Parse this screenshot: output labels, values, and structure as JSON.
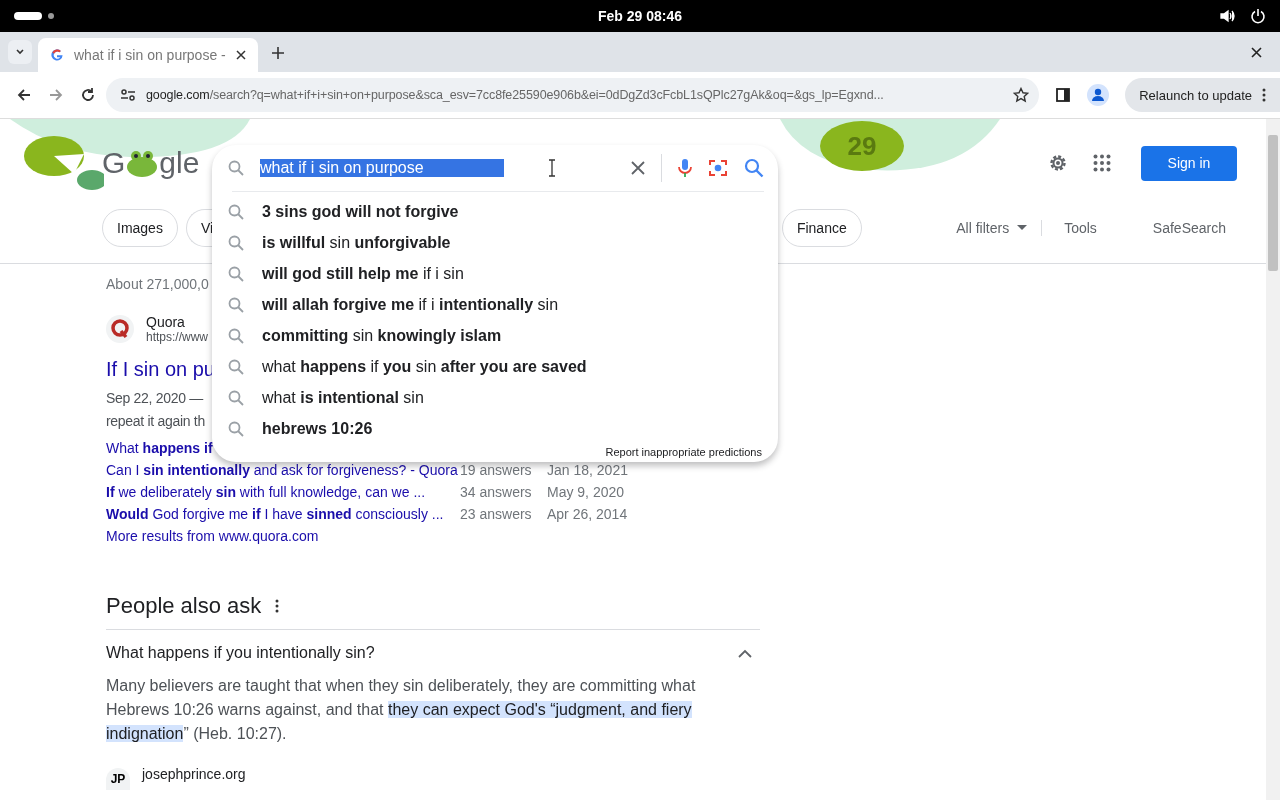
{
  "system_bar": {
    "clock": "Feb 29  08:46"
  },
  "tabs": [
    {
      "title": "what if i sin on purpose -",
      "selected": true
    }
  ],
  "toolbar": {
    "url_host": "google.com",
    "url_path": "/search?q=what+if+i+sin+on+purpose&sca_esv=7cc8fe25590e906b&ei=0dDgZd3cFcbL1sQPlc27gAk&oq=&gs_lp=Egxnd...",
    "relaunch": "Relaunch to update"
  },
  "logo": {
    "left": "G",
    "right": "gle",
    "doodle_number": "29"
  },
  "search": {
    "value": "what if i sin on purpose",
    "selected": true
  },
  "suggestions": [
    {
      "text": "**3 sins god will not forgive**"
    },
    {
      "text": "**is willful** sin **unforgivable**"
    },
    {
      "text": "**will god still help me** if i sin"
    },
    {
      "text": "**will allah forgive me** if i **intentionally** sin"
    },
    {
      "text": "**committing** sin **knowingly islam**"
    },
    {
      "text": "what **happens** if **you** sin **after you are saved**"
    },
    {
      "text": "what **is intentional** sin"
    },
    {
      "text": "**hebrews 10:26**"
    }
  ],
  "report_link": "Report inappropriate predictions",
  "sign_in": "Sign in",
  "chips": [
    {
      "label": "Images"
    },
    {
      "label": "Vi"
    },
    {
      "label": "Finance"
    }
  ],
  "filters": [
    {
      "label": "All filters",
      "kind": "dropdown"
    },
    {
      "label": "Tools",
      "kind": "plain"
    },
    {
      "label": "SafeSearch",
      "kind": "plain"
    }
  ],
  "result_stats": "About 271,000,0",
  "result": {
    "site": "Quora",
    "url": "https://www",
    "title": "If I sin on pu",
    "snippet_lines": [
      "Sep 22, 2020 —",
      "repeat it again th"
    ],
    "related": [
      {
        "title": "What **happens** **if**"
      },
      {
        "title": "Can I **sin intentionally** and ask for forgiveness? - Quora",
        "answers": "19 answers",
        "date": "Jan 18, 2021"
      },
      {
        "title": "**If** we deliberately **sin** with full knowledge, can we ...",
        "answers": "34 answers",
        "date": "May 9, 2020"
      },
      {
        "title": "**Would** God forgive me **if** I have **sinned** consciously ...",
        "answers": "23 answers",
        "date": "Apr 26, 2014"
      }
    ],
    "more": "More results from www.quora.com"
  },
  "people_also_ask": {
    "heading": "People also ask",
    "question": "What happens if you intentionally sin?",
    "expanded": true,
    "answer": [
      {
        "text": "Many believers are taught that when they sin deliberately, they are committing what Hebrews 10:26 warns against, and that ",
        "highlighted": false
      },
      {
        "text": "they can expect God's “judgment, and fiery indignation",
        "highlighted": true
      },
      {
        "text": "” (Heb. 10:27).",
        "highlighted": false
      }
    ],
    "source": {
      "initials": "JP",
      "site": "josephprince.org"
    }
  }
}
